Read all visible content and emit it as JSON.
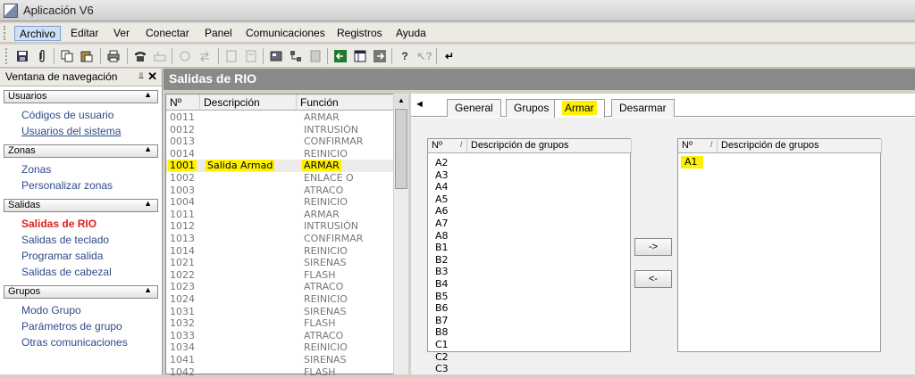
{
  "window": {
    "title": "Aplicación V6"
  },
  "menu": [
    "Archivo",
    "Editar",
    "Ver",
    "Conectar",
    "Panel",
    "Comunicaciones",
    "Registros",
    "Ayuda"
  ],
  "toolbar_icons": [
    "save-icon",
    "clip-icon",
    "copy-icon",
    "paste-icon",
    "print-icon",
    "phone-icon",
    "modem-icon",
    "hand-icon",
    "transfer-icon",
    "doc-icon",
    "doc2-icon",
    "config-icon",
    "tree-icon",
    "calc-icon",
    "arrow-left-icon",
    "window-icon",
    "arrow-right-icon",
    "help-icon",
    "help-pointer-icon",
    "enter-icon"
  ],
  "nav": {
    "title": "Ventana de navegación",
    "pin": "⫫",
    "close": "✕",
    "sections": [
      {
        "label": "Usuarios",
        "items": [
          "Códigos de usuario",
          "Usuarios del sistema"
        ]
      },
      {
        "label": "Zonas",
        "items": [
          "Zonas",
          "Personalizar zonas"
        ]
      },
      {
        "label": "Salidas",
        "items": [
          "Salidas de RIO",
          "Salidas de teclado",
          "Programar salida",
          "Salidas de cabezal"
        ]
      },
      {
        "label": "Grupos",
        "items": [
          "Modo Grupo",
          "Parámetros de grupo",
          "Otras comunicaciones"
        ]
      }
    ]
  },
  "main": {
    "title": "Salidas de RIO"
  },
  "rio_table": {
    "columns": [
      "Nº",
      "Descripción",
      "Función"
    ],
    "rows": [
      {
        "n": "0011",
        "d": "",
        "f": "ARMAR"
      },
      {
        "n": "0012",
        "d": "",
        "f": "INTRUSIÓN"
      },
      {
        "n": "0013",
        "d": "",
        "f": "CONFIRMAR"
      },
      {
        "n": "0014",
        "d": "",
        "f": "REINICIO"
      },
      {
        "n": "1001",
        "d": "Salida Armad",
        "f": "ARMAR"
      },
      {
        "n": "1002",
        "d": "",
        "f": "ENLACE O"
      },
      {
        "n": "1003",
        "d": "",
        "f": "ATRACO"
      },
      {
        "n": "1004",
        "d": "",
        "f": "REINICIO"
      },
      {
        "n": "1011",
        "d": "",
        "f": "ARMAR"
      },
      {
        "n": "1012",
        "d": "",
        "f": "INTRUSIÓN"
      },
      {
        "n": "1013",
        "d": "",
        "f": "CONFIRMAR"
      },
      {
        "n": "1014",
        "d": "",
        "f": "REINICIO"
      },
      {
        "n": "1021",
        "d": "",
        "f": "SIRENAS"
      },
      {
        "n": "1022",
        "d": "",
        "f": "FLASH"
      },
      {
        "n": "1023",
        "d": "",
        "f": "ATRACO"
      },
      {
        "n": "1024",
        "d": "",
        "f": "REINICIO"
      },
      {
        "n": "1031",
        "d": "",
        "f": "SIRENAS"
      },
      {
        "n": "1032",
        "d": "",
        "f": "FLASH"
      },
      {
        "n": "1033",
        "d": "",
        "f": "ATRACO"
      },
      {
        "n": "1034",
        "d": "",
        "f": "REINICIO"
      },
      {
        "n": "1041",
        "d": "",
        "f": "SIRENAS"
      },
      {
        "n": "1042",
        "d": "",
        "f": "FLASH"
      }
    ]
  },
  "tabs": [
    "General",
    "Grupos",
    "Armar",
    "Desarmar"
  ],
  "left_groups": {
    "col1": "Nº",
    "col2": "Descripción de grupos",
    "items": [
      "A2",
      "A3",
      "A4",
      "A5",
      "A6",
      "A7",
      "A8",
      "B1",
      "B2",
      "B3",
      "B4",
      "B5",
      "B6",
      "B7",
      "B8",
      "C1",
      "C2",
      "C3"
    ]
  },
  "right_groups": {
    "col1": "Nº",
    "col2": "Descripción de grupos",
    "items": [
      "A1"
    ]
  },
  "buttons": {
    "add": "->",
    "remove": "<-"
  },
  "colors": {
    "highlight": "#fff000",
    "nav_active": "#e0201a",
    "nav_link": "#2f4a8a",
    "header_bg": "#8a8a8a"
  }
}
